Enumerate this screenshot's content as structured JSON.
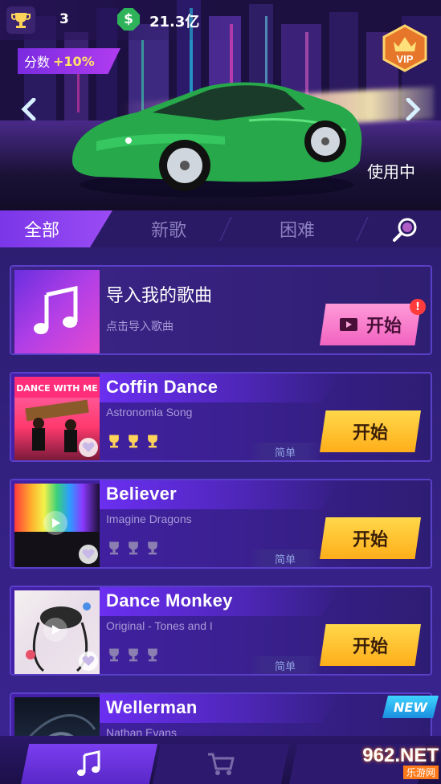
{
  "header": {
    "trophy_count": "3",
    "cash_amount": "21.3亿",
    "cash_symbol": "$",
    "score_label": "分数",
    "score_boost": "+10%",
    "vip_label": "VIP",
    "in_use_label": "使用中"
  },
  "tabs": [
    {
      "label": "全部"
    },
    {
      "label": "新歌"
    },
    {
      "label": "困难"
    }
  ],
  "import_card": {
    "title": "导入我的歌曲",
    "subtitle": "点击导入歌曲",
    "button_label": "开始",
    "alert": "!"
  },
  "songs": [
    {
      "title": "Coffin Dance",
      "artist": "Astronomia Song",
      "difficulty": "简单",
      "button_label": "开始",
      "trophies_earned": 3,
      "trophies_total": 3
    },
    {
      "title": "Believer",
      "artist": "Imagine Dragons",
      "difficulty": "简单",
      "button_label": "开始",
      "trophies_earned": 0,
      "trophies_total": 3
    },
    {
      "title": "Dance Monkey",
      "artist": "Original - Tones and I",
      "difficulty": "简单",
      "button_label": "开始",
      "trophies_earned": 0,
      "trophies_total": 3
    },
    {
      "title": "Wellerman",
      "artist": "Nathan Evans",
      "badge": "NEW"
    }
  ],
  "thumb_text": {
    "coffin_dance": "DANCE WITH ME"
  },
  "watermark": {
    "top": "962.NET",
    "bottom": "乐游网"
  },
  "colors": {
    "accent_purple": "#7a36e8",
    "start_yellow": "#ffd84a",
    "start_pink": "#f163c0",
    "new_blue": "#3fd4ff",
    "trophy_gold": "#ffd35a"
  },
  "icons": [
    "trophy-icon",
    "cash-icon",
    "vip-crown-icon",
    "arrow-left-icon",
    "arrow-right-icon",
    "search-icon",
    "music-note-icon",
    "heart-icon",
    "play-icon",
    "cart-icon"
  ]
}
